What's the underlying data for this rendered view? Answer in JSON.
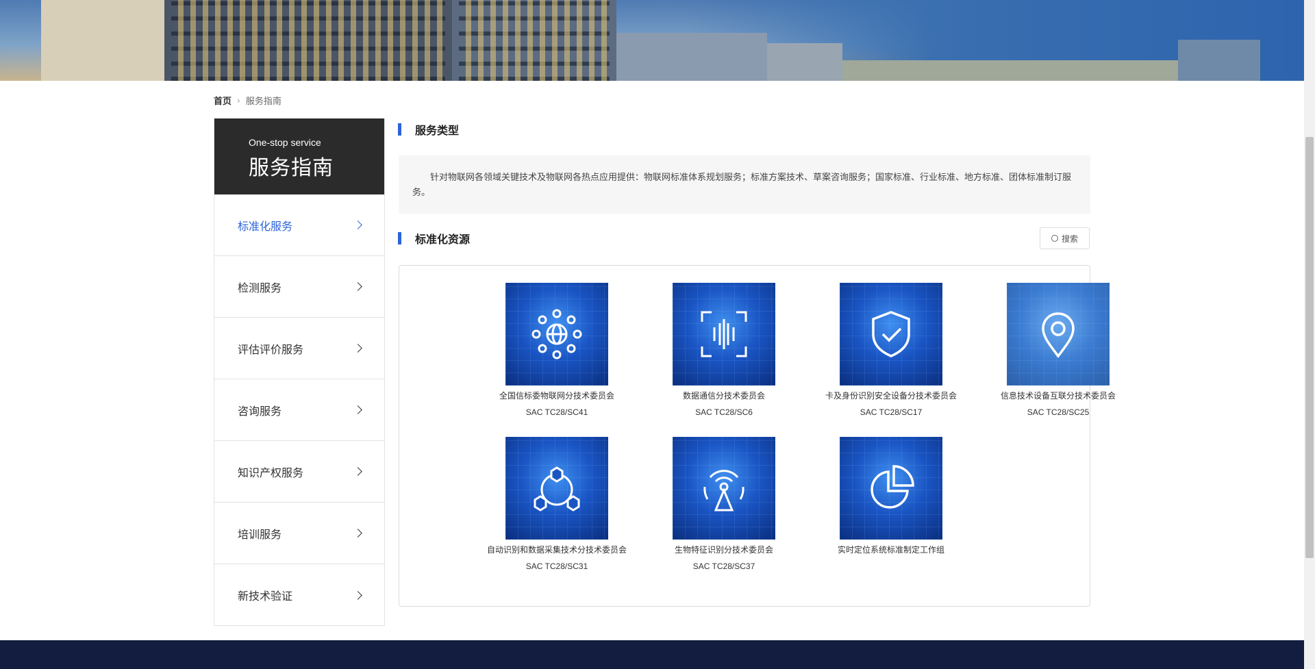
{
  "breadcrumb": {
    "home": "首页",
    "current": "服务指南"
  },
  "sidebar": {
    "subtitle_en": "One-stop service",
    "title": "服务指南",
    "items": [
      {
        "label": "标准化服务",
        "active": true
      },
      {
        "label": "检测服务"
      },
      {
        "label": "评估评价服务"
      },
      {
        "label": "咨询服务"
      },
      {
        "label": "知识产权服务"
      },
      {
        "label": "培训服务"
      },
      {
        "label": "新技术验证"
      }
    ]
  },
  "service_type": {
    "title": "服务类型",
    "description": "针对物联网各领域关键技术及物联网各热点应用提供：物联网标准体系规划服务；标准方案技术、草案咨询服务；国家标准、行业标准、地方标准、团体标准制订服务。"
  },
  "resources": {
    "title": "标准化资源",
    "search_label": "搜索",
    "cards": [
      {
        "name": "全国信标委物联网分技术委员会",
        "code": "SAC TC28/SC41",
        "icon": "globe-network-icon"
      },
      {
        "name": "数据通信分技术委员会",
        "code": "SAC TC28/SC6",
        "icon": "scan-frame-icon"
      },
      {
        "name": "卡及身份识别安全设备分技术委员会",
        "code": "SAC TC28/SC17",
        "icon": "shield-check-icon"
      },
      {
        "name": "信息技术设备互联分技术委员会",
        "code": "SAC TC28/SC25",
        "icon": "location-pin-icon"
      },
      {
        "name": "自动识别和数据采集技术分技术委员会",
        "code": "SAC TC28/SC31",
        "icon": "hex-network-icon"
      },
      {
        "name": "生物特征识别分技术委员会",
        "code": "SAC TC28/SC37",
        "icon": "broadcast-tower-icon"
      },
      {
        "name": "实时定位系统标准制定工作组",
        "code": "",
        "icon": "pie-chart-icon"
      }
    ]
  },
  "colors": {
    "accent": "#2c64d8",
    "sidebar_head": "#2b2b2b",
    "footer": "#131d3f"
  }
}
